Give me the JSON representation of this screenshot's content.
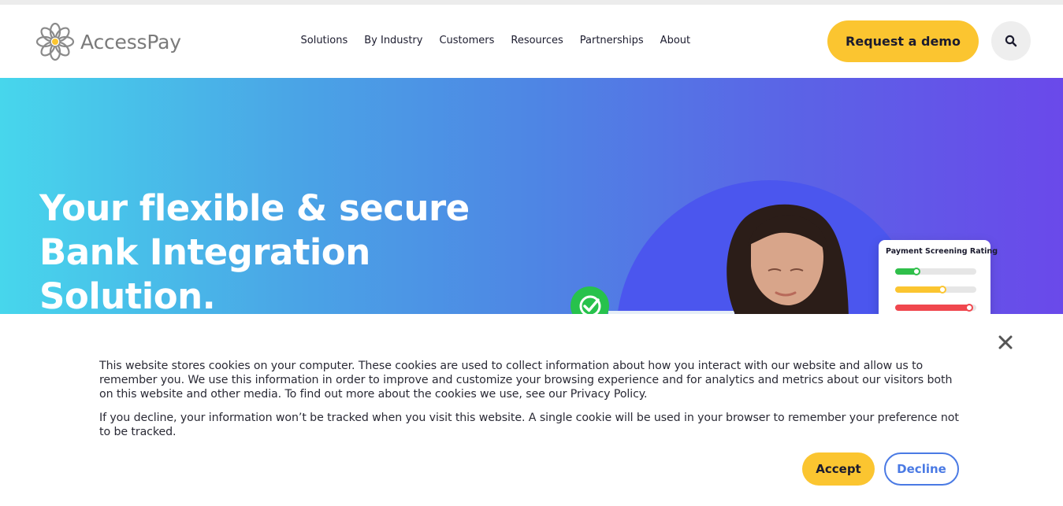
{
  "header": {
    "logo_text": "AccessPay",
    "nav": [
      "Solutions",
      "By Industry",
      "Customers",
      "Resources",
      "Partnerships",
      "About"
    ],
    "demo_button": "Request a demo",
    "search_icon": "search-icon"
  },
  "hero": {
    "title": "Your flexible & secure\nBank Integration\nSolution.",
    "rating_card": {
      "title": "Payment Screening Rating",
      "bars": [
        {
          "color": "#2fbf4a",
          "fill": 0.3
        },
        {
          "color": "#fbc530",
          "fill": 0.62
        },
        {
          "color": "#f0474e",
          "fill": 0.95
        }
      ]
    },
    "check_icon": "check-circle-icon"
  },
  "cookie_banner": {
    "paragraph1": "This website stores cookies on your computer. These cookies are used to collect information about how you interact with our website and allow us to remember you. We use this information in order to improve and customize your browsing experience and for analytics and metrics about our visitors both on this website and other media. To find out more about the cookies we use, see our Privacy Policy.",
    "paragraph2": "If you decline, your information won’t be tracked when you visit this website. A single cookie will be used in your browser to remember your preference not to be tracked.",
    "accept": "Accept",
    "decline": "Decline",
    "close_icon": "close-icon"
  },
  "colors": {
    "accent_yellow": "#fbc530",
    "decline_blue": "#4a7ae4"
  }
}
